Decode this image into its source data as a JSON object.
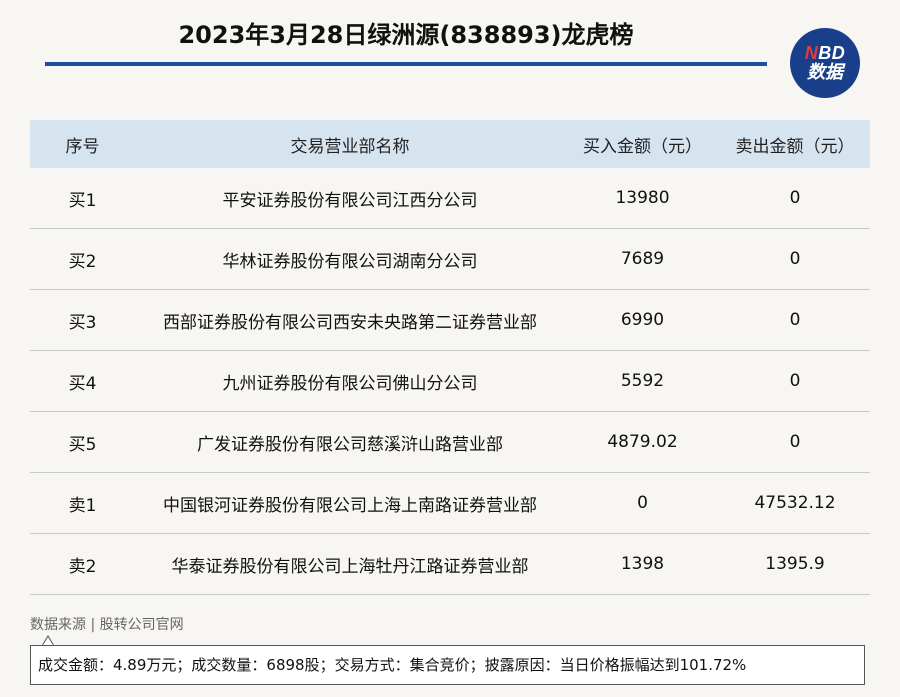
{
  "title": "2023年3月28日绿洲源(838893)龙虎榜",
  "logo": {
    "text_n": "N",
    "text_bd": "BD",
    "text_line2": "数据"
  },
  "table": {
    "headers": [
      "序号",
      "交易营业部名称",
      "买入金额（元）",
      "卖出金额（元）"
    ],
    "rows": [
      [
        "买1",
        "平安证券股份有限公司江西分公司",
        "13980",
        "0"
      ],
      [
        "买2",
        "华林证券股份有限公司湖南分公司",
        "7689",
        "0"
      ],
      [
        "买3",
        "西部证券股份有限公司西安未央路第二证券营业部",
        "6990",
        "0"
      ],
      [
        "买4",
        "九州证券股份有限公司佛山分公司",
        "5592",
        "0"
      ],
      [
        "买5",
        "广发证券股份有限公司慈溪浒山路营业部",
        "4879.02",
        "0"
      ],
      [
        "卖1",
        "中国银河证券股份有限公司上海上南路证券营业部",
        "0",
        "47532.12"
      ],
      [
        "卖2",
        "华泰证券股份有限公司上海牡丹江路证券营业部",
        "1398",
        "1395.9"
      ]
    ]
  },
  "source": "数据来源 | 股转公司官网",
  "note": "成交金额：4.89万元；成交数量：6898股；交易方式：集合竞价；披露原因：当日价格振幅达到101.72%",
  "colors": {
    "accent": "#1d4f9c",
    "header_bg": "#d6e4f0",
    "logo_bg": "#1a3f8a",
    "logo_red": "#e33a3a"
  }
}
